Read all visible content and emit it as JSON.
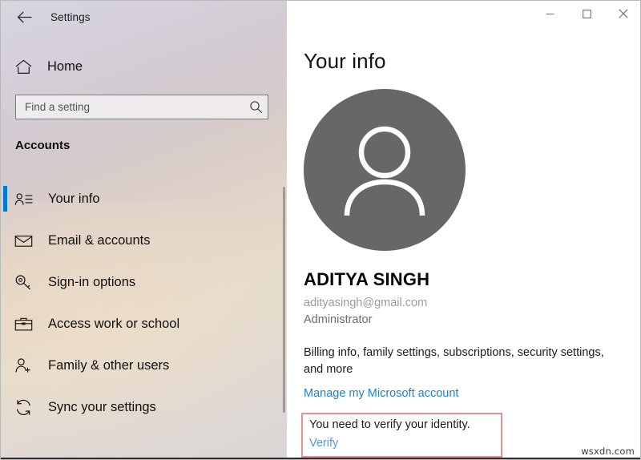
{
  "window": {
    "app_title": "Settings",
    "back_icon": "back-arrow-icon",
    "controls": {
      "minimize": "minimize-icon",
      "maximize": "maximize-icon",
      "close": "close-icon"
    }
  },
  "sidebar": {
    "home": {
      "label": "Home",
      "icon": "home-icon"
    },
    "search": {
      "placeholder": "Find a setting",
      "value": "",
      "icon": "search-icon"
    },
    "section_title": "Accounts",
    "items": [
      {
        "label": "Your info",
        "icon": "contact-card-icon",
        "selected": true
      },
      {
        "label": "Email & accounts",
        "icon": "envelope-icon",
        "selected": false
      },
      {
        "label": "Sign-in options",
        "icon": "key-icon",
        "selected": false
      },
      {
        "label": "Access work or school",
        "icon": "briefcase-icon",
        "selected": false
      },
      {
        "label": "Family & other users",
        "icon": "person-plus-icon",
        "selected": false
      },
      {
        "label": "Sync your settings",
        "icon": "sync-icon",
        "selected": false
      }
    ]
  },
  "main": {
    "page_title": "Your info",
    "avatar": {
      "icon": "person-avatar-icon",
      "background_color": "#676767"
    },
    "user_name": "ADITYA SINGH",
    "user_email": "adityasingh@gmail.com",
    "user_role": "Administrator",
    "description": "Billing info, family settings, subscriptions, security settings, and more",
    "manage_link": "Manage my Microsoft account",
    "verify": {
      "message": "You need to verify your identity.",
      "link": "Verify",
      "highlight_color": "#e8908f"
    }
  },
  "watermark": "wsxdn.com",
  "colors": {
    "accent": "#0078d7",
    "link": "#1d7fd0",
    "annotation": "#e8908f"
  }
}
